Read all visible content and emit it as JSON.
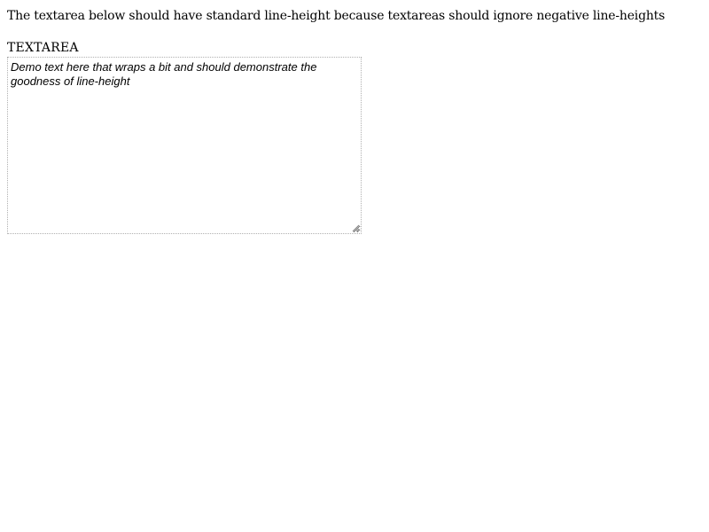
{
  "intro": {
    "text": "The textarea below should have standard line-height because textareas should ignore negative line-heights"
  },
  "field": {
    "label": "TEXTAREA",
    "value": "Demo text here that wraps a bit and should demonstrate the goodness of line-height"
  },
  "icons": {
    "resize": "resize-grip-icon"
  }
}
